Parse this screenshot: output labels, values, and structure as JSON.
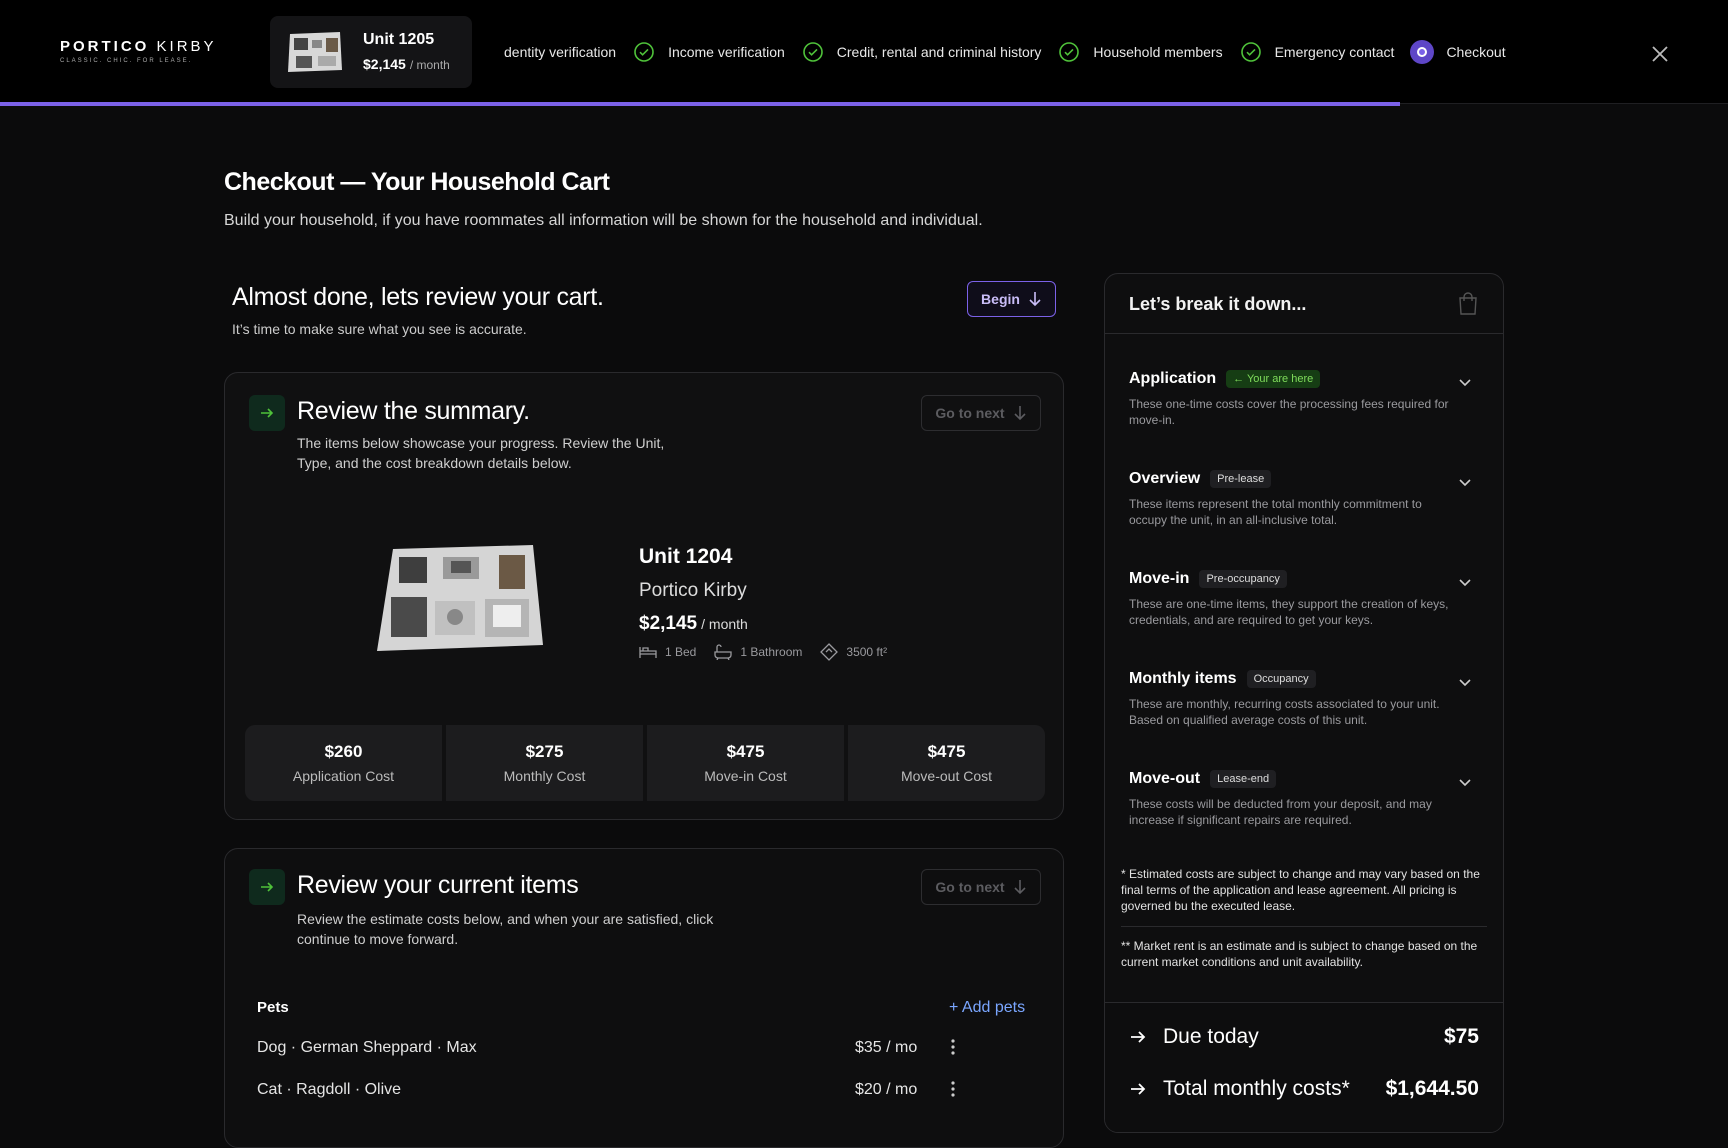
{
  "header": {
    "logo_main": "PORTICO",
    "logo_second": "KIRBY",
    "logo_tagline": "CLASSIC. CHIC. FOR LEASE.",
    "unit_name": "Unit 1205",
    "unit_price": "$2,145",
    "unit_price_period": "/ month",
    "steps": [
      {
        "label": "dentity verification",
        "status": "complete"
      },
      {
        "label": "Income verification",
        "status": "complete"
      },
      {
        "label": "Credit, rental and criminal history",
        "status": "complete"
      },
      {
        "label": "Household members",
        "status": "complete"
      },
      {
        "label": "Emergency contact",
        "status": "complete"
      },
      {
        "label": "Checkout",
        "status": "current"
      }
    ],
    "progress_percent": 81
  },
  "page": {
    "title": "Checkout — Your Household Cart",
    "subtitle": "Build your household, if you have roommates all information will be shown for the household and individual.",
    "review_heading": "Almost done, lets review your cart.",
    "review_sub": "It’s time to make sure what you see is accurate.",
    "begin_label": "Begin"
  },
  "summary_card": {
    "title": "Review the summary.",
    "desc": "The items below showcase your progress. Review the Unit, Type, and the cost breakdown details below.",
    "go_next": "Go to next",
    "unit_name": "Unit 1204",
    "property": "Portico Kirby",
    "price": "$2,145",
    "period": "/ month",
    "beds": "1 Bed",
    "baths": "1 Bathroom",
    "area": "3500 ft²",
    "costs": [
      {
        "value": "$260",
        "label": "Application Cost"
      },
      {
        "value": "$275",
        "label": "Monthly Cost"
      },
      {
        "value": "$475",
        "label": "Move-in Cost"
      },
      {
        "value": "$475",
        "label": "Move-out Cost"
      }
    ]
  },
  "items_card": {
    "title": "Review your current items",
    "desc": "Review the estimate costs below, and when your are satisfied, click continue to move forward.",
    "go_next": "Go to next",
    "pets_heading": "Pets",
    "add_pets": "+ Add pets",
    "pets": [
      {
        "label": "Dog · German Sheppard · Max",
        "price": "$35 / mo"
      },
      {
        "label": "Cat · Ragdoll · Olive",
        "price": "$20 / mo"
      }
    ]
  },
  "breakdown": {
    "title": "Let’s break it down...",
    "sections": [
      {
        "title": "Application",
        "tag": "Your are here",
        "desc": "These one-time costs cover the processing fees required for move-in."
      },
      {
        "title": "Overview",
        "tag": "Pre-lease",
        "desc": "These items represent the total monthly commitment to occupy the unit, in an all-inclusive total."
      },
      {
        "title": "Move-in",
        "tag": "Pre-occupancy",
        "desc": "These are one-time items, they support the creation of keys, credentials, and are required to get your keys."
      },
      {
        "title": "Monthly items",
        "tag": "Occupancy",
        "desc": "These are monthly, recurring costs associated to your unit. Based on qualified average costs of this unit."
      },
      {
        "title": "Move-out",
        "tag": "Lease-end",
        "desc": "These costs will be deducted from your deposit, and may increase if significant repairs are required."
      }
    ],
    "note1": "* Estimated costs are subject to change and may vary based on the final terms of the application and lease agreement. All pricing is governed bu the executed lease.",
    "note2": "** Market rent is an estimate and is subject to change based on the current market conditions and unit availability.",
    "due_today_label": "Due today",
    "due_today_amount": "$75",
    "monthly_label": "Total monthly costs*",
    "monthly_amount": "$1,644.50"
  },
  "colors": {
    "accent": "#7b61e8",
    "success": "#4fc23a",
    "link": "#7aa6ff"
  }
}
